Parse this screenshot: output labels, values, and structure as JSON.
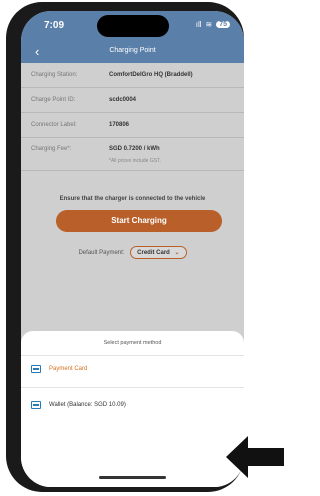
{
  "status_bar": {
    "time": "7:09",
    "signal": "ıll",
    "wifi": "≋",
    "battery": "75"
  },
  "navbar": {
    "back_icon": "chevron-left-icon",
    "title": "Charging Point"
  },
  "details": [
    {
      "label": "Charging Station:",
      "value": "ComfortDelGro HQ (Braddell)"
    },
    {
      "label": "Charge Point ID:",
      "value": "scdc0004"
    },
    {
      "label": "Connector Label:",
      "value": "170806"
    },
    {
      "label": "Charging Fee*:",
      "value": "SGD 0.7200 / kWh",
      "note": "*All prices include GST."
    }
  ],
  "ensure_text": "Ensure that the charger is connected to the vehicle",
  "start_button": "Start Charging",
  "default_payment": {
    "label": "Default Payment:",
    "selected": "Credit Card"
  },
  "sheet": {
    "title": "Select payment method",
    "options": [
      {
        "label": "Payment Card",
        "icon": "credit-card-icon",
        "color": "#d4701e"
      },
      {
        "label": "Wallet (Balance: SGD 10.09)",
        "icon": "wallet-icon",
        "color": "#333333"
      }
    ]
  },
  "colors": {
    "accent": "#b85f2a",
    "header": "#5a7fa8",
    "icon": "#2a7ab8"
  }
}
